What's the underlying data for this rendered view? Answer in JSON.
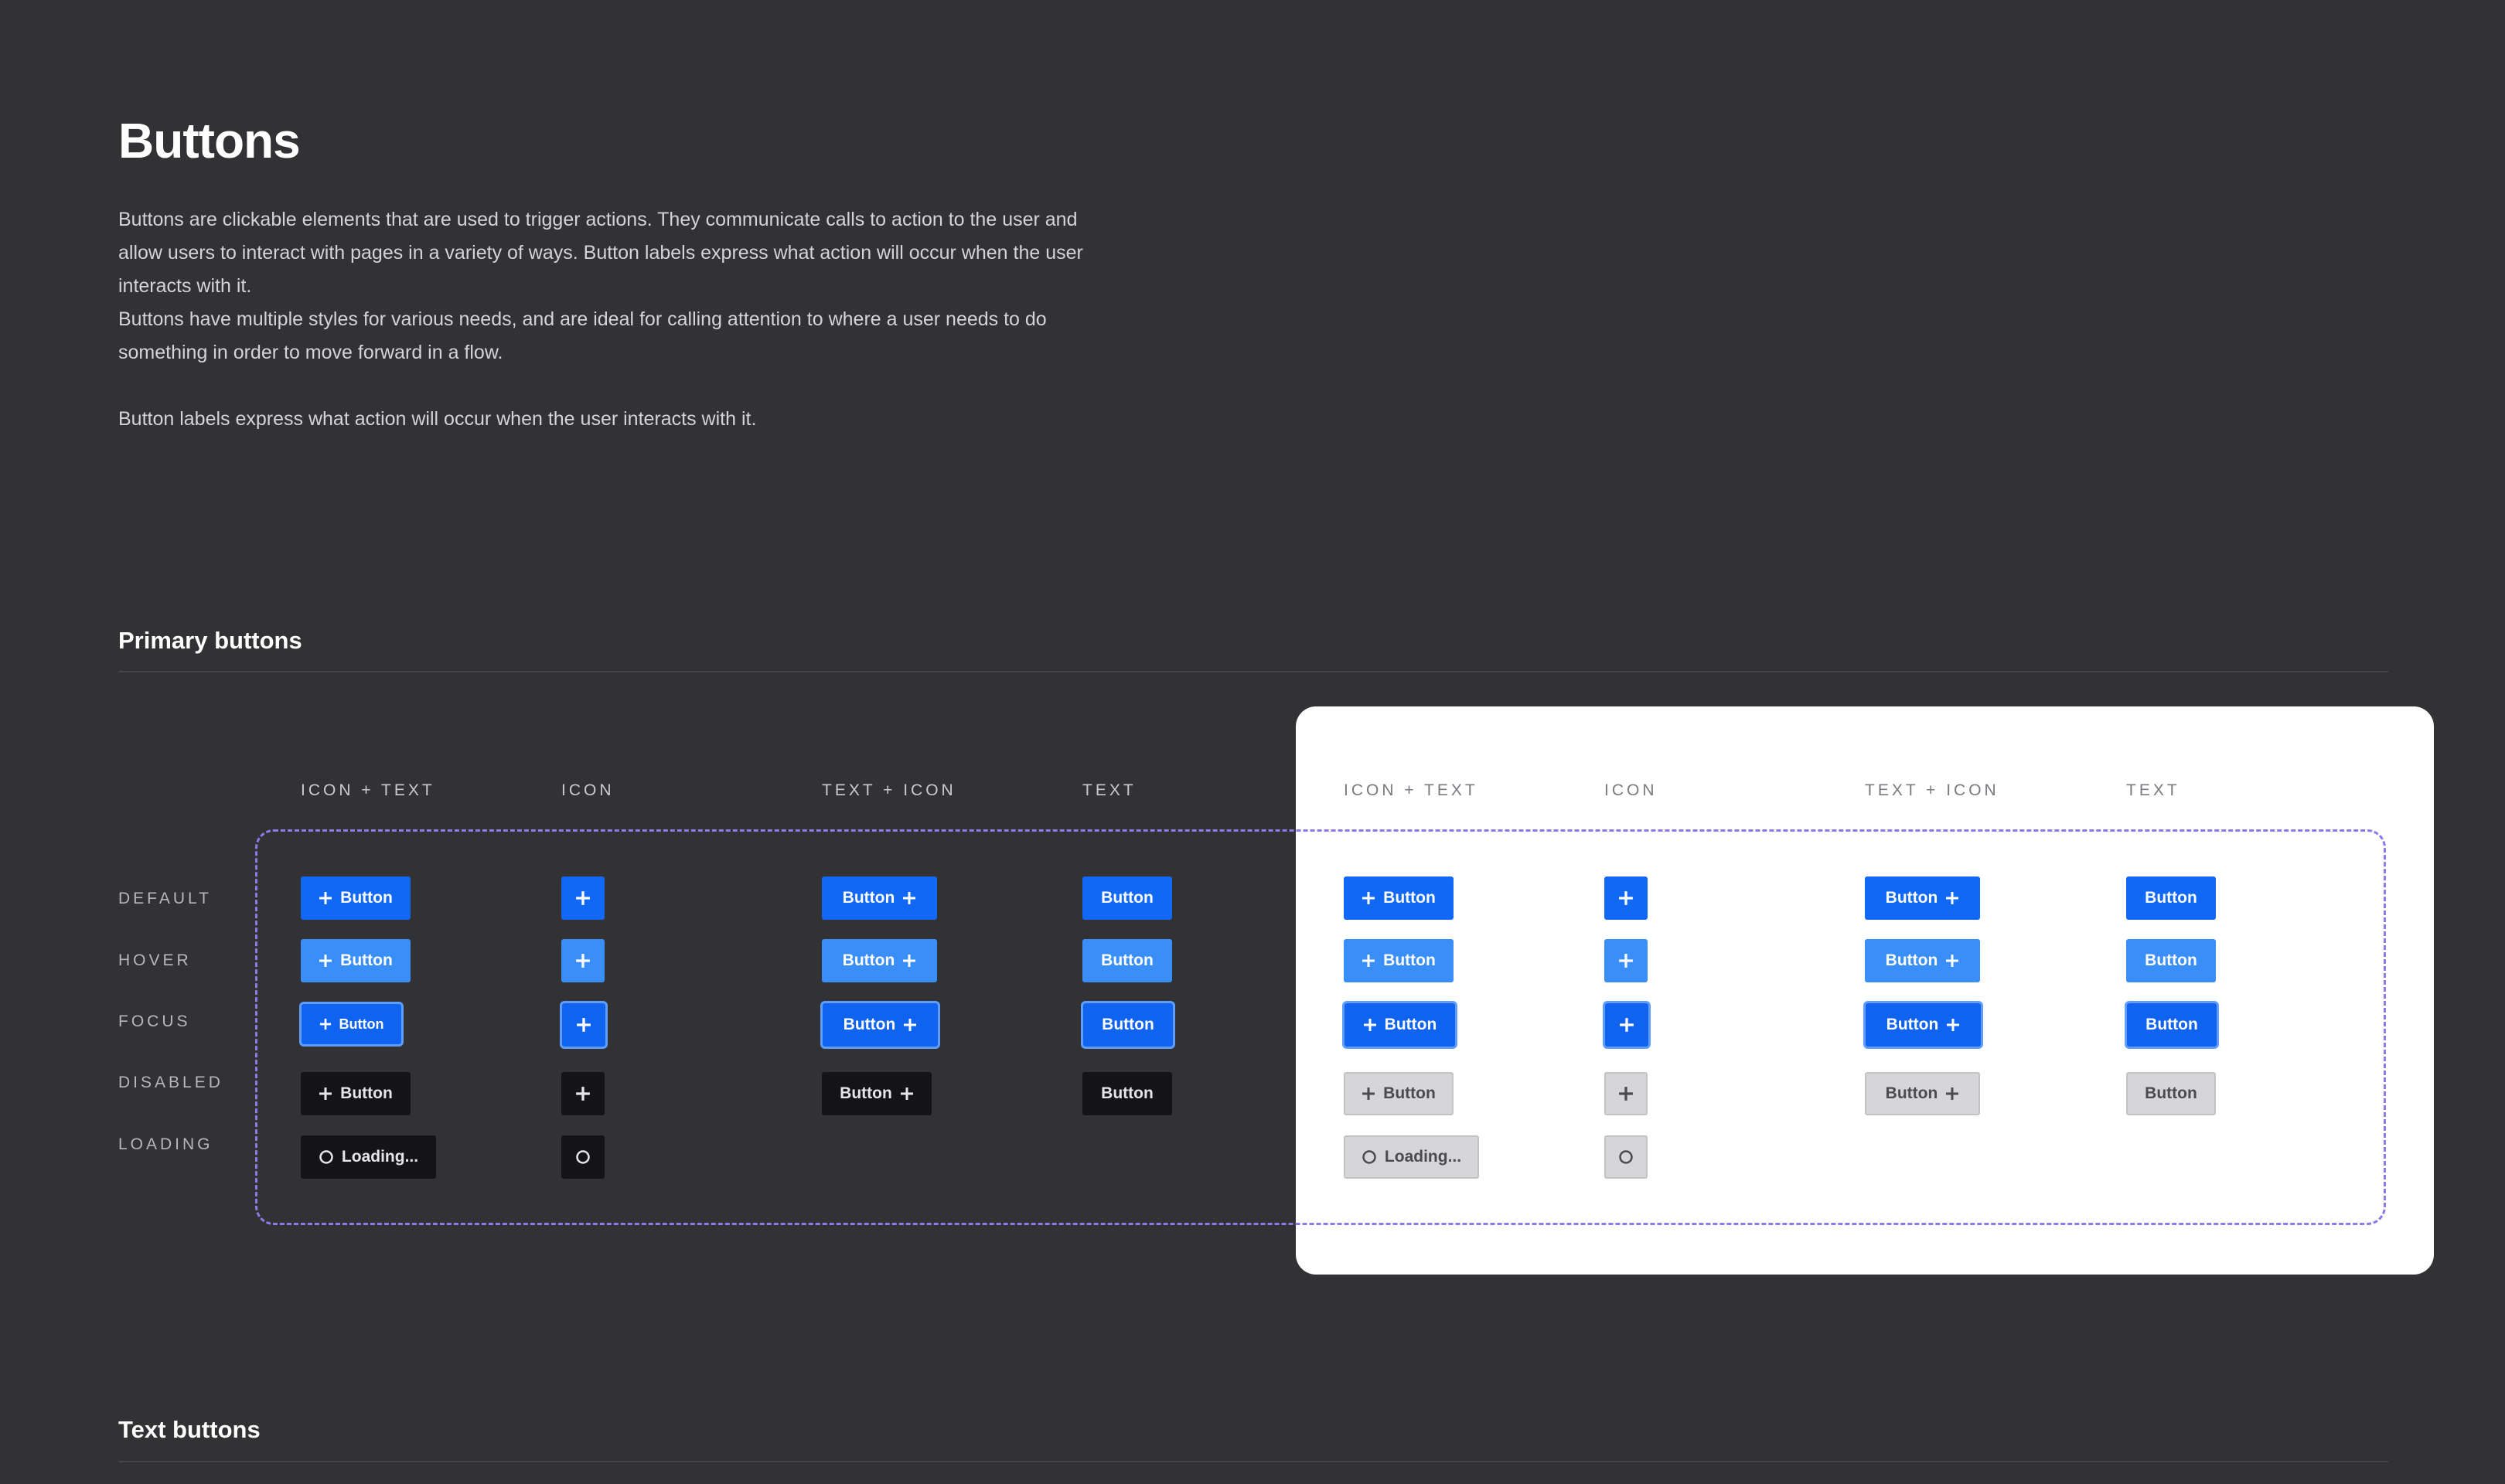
{
  "page": {
    "title": "Buttons",
    "intro": [
      "Buttons are clickable elements that are used to trigger actions. They communicate calls to action to the user and allow users to interact with pages in a variety of ways. Button labels express what action will occur when the user interacts with it.",
      "Buttons have multiple styles for various needs, and are ideal for calling attention to where a user needs to do something in order to move forward in a flow.",
      "Button labels express what action will occur when the user interacts with it."
    ]
  },
  "sections": {
    "primary": "Primary buttons",
    "text": "Text buttons"
  },
  "columns": [
    "ICON + TEXT",
    "ICON",
    "TEXT + ICON",
    "TEXT"
  ],
  "rows": [
    "DEFAULT",
    "HOVER",
    "FOCUS",
    "DISABLED",
    "LOADING"
  ],
  "button": {
    "label": "Button",
    "loading_label": "Loading..."
  },
  "icons": {
    "plus": "plus-icon",
    "spinner": "loading-spinner-icon"
  },
  "colors": {
    "background": "#323134",
    "primary": "#1068f5",
    "hover": "#3a8ef8",
    "focus_ring": "#5f9dff",
    "disabled_dark": "#141416",
    "disabled_light": "#d6d6d8",
    "panel_light": "#ffffff",
    "frame_dashed": "#8a7be8"
  }
}
